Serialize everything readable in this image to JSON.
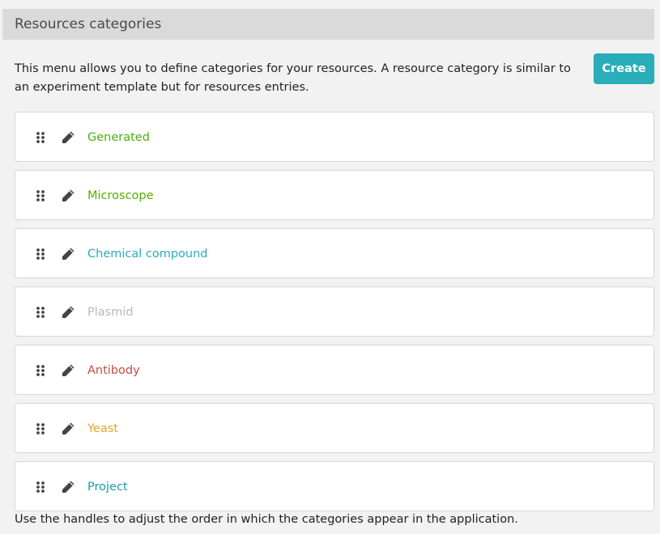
{
  "header": {
    "title": "Resources categories"
  },
  "intro": {
    "text": "This menu allows you to define categories for your resources. A resource category is similar to an experiment template but for resources entries.",
    "create_label": "Create"
  },
  "categories": [
    {
      "name": "Generated",
      "color": "#4caf11"
    },
    {
      "name": "Microscope",
      "color": "#55ad00"
    },
    {
      "name": "Chemical compound",
      "color": "#29aeb9"
    },
    {
      "name": "Plasmid",
      "color": "#b9b9b9"
    },
    {
      "name": "Antibody",
      "color": "#c24f3d"
    },
    {
      "name": "Yeast",
      "color": "#e8a324"
    },
    {
      "name": "Project",
      "color": "#1a9baa"
    }
  ],
  "icons": {
    "drag": "drag-handle-icon",
    "edit": "pencil-icon"
  },
  "footer": {
    "note": "Use the handles to adjust the order in which the categories appear in the application."
  }
}
